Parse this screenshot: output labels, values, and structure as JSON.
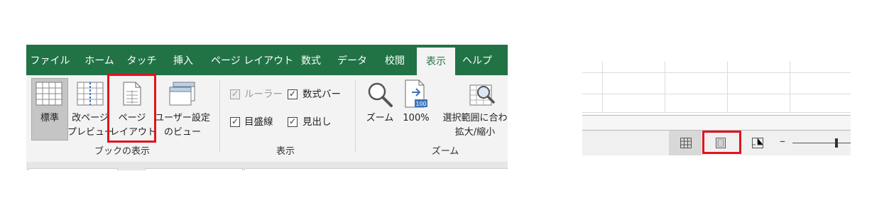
{
  "ribbon": {
    "tabs": [
      {
        "label": "ファイル"
      },
      {
        "label": "ホーム"
      },
      {
        "label": "タッチ"
      },
      {
        "label": "挿入"
      },
      {
        "label": "ページ レイアウト"
      },
      {
        "label": "数式"
      },
      {
        "label": "データ"
      },
      {
        "label": "校閲"
      },
      {
        "label": "表示",
        "active": true
      },
      {
        "label": "ヘルプ"
      }
    ],
    "workbook_views": {
      "normal": "標準",
      "page_break_line1": "改ページ",
      "page_break_line2": "プレビュー",
      "page_layout_line1": "ページ",
      "page_layout_line2": "レイアウト",
      "custom_line1": "ユーザー設定",
      "custom_line2": "のビュー",
      "group_label": "ブックの表示"
    },
    "show": {
      "ruler": {
        "label": "ルーラー",
        "checked": true,
        "disabled": true
      },
      "formula_bar": {
        "label": "数式バー",
        "checked": true
      },
      "gridlines": {
        "label": "目盛線",
        "checked": true
      },
      "headings": {
        "label": "見出し",
        "checked": true
      },
      "group_label": "表示"
    },
    "zoom": {
      "zoom_label": "ズーム",
      "hundred_label": "100%",
      "hundred_icon_badge": "100",
      "zoom_selection_line1": "選択範囲に合わ",
      "zoom_selection_line2": "拡大/縮小",
      "group_label": "ズーム"
    },
    "highlight_color": "#e0141e",
    "accent_color": "#217346"
  },
  "statusbar": {
    "view_buttons": [
      "normal-view-icon",
      "page-layout-view-icon",
      "page-break-view-icon"
    ],
    "zoom_minus": "–"
  }
}
